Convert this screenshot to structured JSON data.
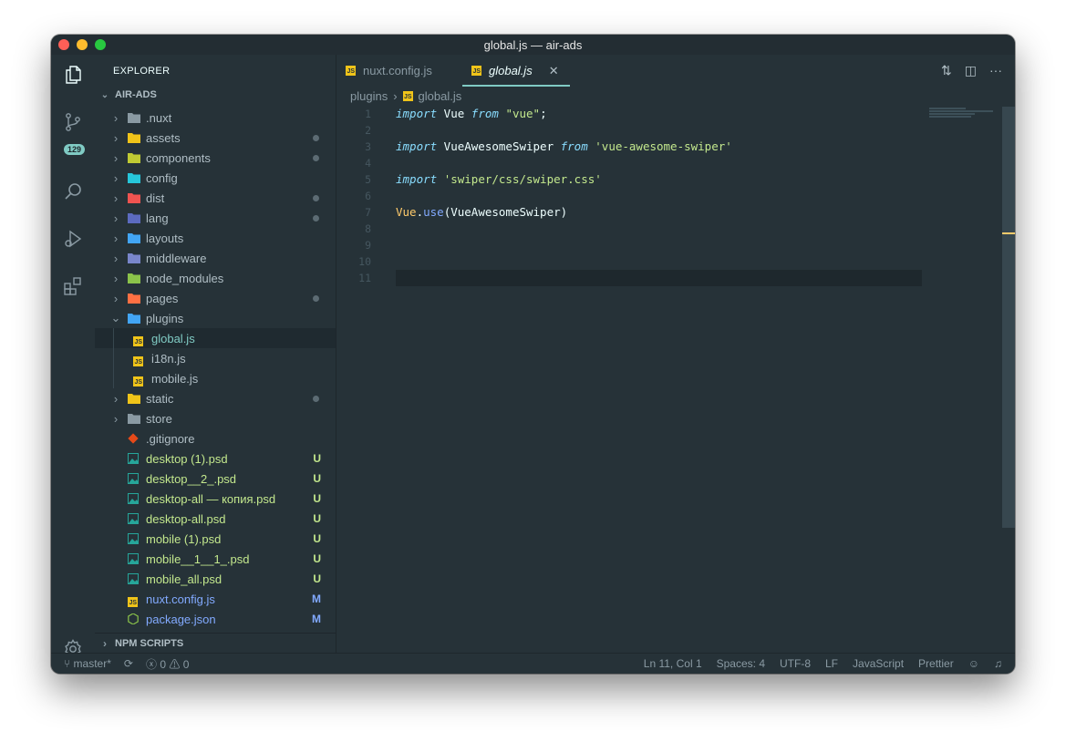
{
  "window": {
    "title": "global.js — air-ads"
  },
  "colors": {
    "accent": "#80cbc4",
    "background": "#263238",
    "untracked": "#c3e88d",
    "modified": "#82aaff"
  },
  "activity": {
    "scm_badge": "129"
  },
  "sidebar": {
    "title": "EXPLORER",
    "project": "AIR-ADS",
    "items": [
      {
        "name": ".nuxt",
        "type": "folder",
        "icon_color": "#8a9aa3",
        "dot": false,
        "status": ""
      },
      {
        "name": "assets",
        "type": "folder",
        "icon_color": "#f0c419",
        "dot": true,
        "status": ""
      },
      {
        "name": "components",
        "type": "folder",
        "icon_color": "#c0ca33",
        "dot": true,
        "status": ""
      },
      {
        "name": "config",
        "type": "folder",
        "icon_color": "#26c6da",
        "dot": false,
        "status": ""
      },
      {
        "name": "dist",
        "type": "folder",
        "icon_color": "#ef5350",
        "dot": true,
        "status": ""
      },
      {
        "name": "lang",
        "type": "folder",
        "icon_color": "#5c6bc0",
        "dot": true,
        "status": ""
      },
      {
        "name": "layouts",
        "type": "folder",
        "icon_color": "#42a5f5",
        "dot": false,
        "status": ""
      },
      {
        "name": "middleware",
        "type": "folder",
        "icon_color": "#7986cb",
        "dot": false,
        "status": ""
      },
      {
        "name": "node_modules",
        "type": "folder",
        "icon_color": "#8bc34a",
        "dot": false,
        "status": ""
      },
      {
        "name": "pages",
        "type": "folder",
        "icon_color": "#ff7043",
        "dot": true,
        "status": ""
      },
      {
        "name": "plugins",
        "type": "folder-open",
        "icon_color": "#42a5f5",
        "dot": false,
        "status": ""
      },
      {
        "name": "global.js",
        "type": "js",
        "dot": false,
        "status": "",
        "nested": true,
        "selected": true
      },
      {
        "name": "i18n.js",
        "type": "js",
        "dot": false,
        "status": "",
        "nested": true
      },
      {
        "name": "mobile.js",
        "type": "js",
        "dot": false,
        "status": "",
        "nested": true
      },
      {
        "name": "static",
        "type": "folder",
        "icon_color": "#f0c419",
        "dot": true,
        "status": ""
      },
      {
        "name": "store",
        "type": "folder",
        "icon_color": "#8a9aa3",
        "dot": false,
        "status": ""
      },
      {
        "name": ".gitignore",
        "type": "git",
        "dot": false,
        "status": ""
      },
      {
        "name": "desktop (1).psd",
        "type": "psd",
        "dot": false,
        "status": "U"
      },
      {
        "name": "desktop__2_.psd",
        "type": "psd",
        "dot": false,
        "status": "U"
      },
      {
        "name": "desktop-all — копия.psd",
        "type": "psd",
        "dot": false,
        "status": "U"
      },
      {
        "name": "desktop-all.psd",
        "type": "psd",
        "dot": false,
        "status": "U"
      },
      {
        "name": "mobile (1).psd",
        "type": "psd",
        "dot": false,
        "status": "U"
      },
      {
        "name": "mobile__1__1_.psd",
        "type": "psd",
        "dot": false,
        "status": "U"
      },
      {
        "name": "mobile_all.psd",
        "type": "psd",
        "dot": false,
        "status": "U"
      },
      {
        "name": "nuxt.config.js",
        "type": "js",
        "dot": false,
        "status": "M"
      },
      {
        "name": "package.json",
        "type": "node",
        "dot": false,
        "status": "M"
      }
    ],
    "npm_scripts": "NPM SCRIPTS"
  },
  "tabs": [
    {
      "label": "nuxt.config.js",
      "active": false
    },
    {
      "label": "global.js",
      "active": true
    }
  ],
  "breadcrumb": {
    "folder": "plugins",
    "file": "global.js"
  },
  "code": {
    "current_line": 11,
    "lines": [
      [
        [
          "kw",
          "import"
        ],
        [
          "t",
          " Vue "
        ],
        [
          "kw",
          "from"
        ],
        [
          "t",
          " "
        ],
        [
          "str",
          "\"vue\""
        ],
        [
          "t",
          ";"
        ]
      ],
      [],
      [
        [
          "kw",
          "import"
        ],
        [
          "t",
          " VueAwesomeSwiper "
        ],
        [
          "kw",
          "from"
        ],
        [
          "t",
          " "
        ],
        [
          "str",
          "'vue-awesome-swiper'"
        ]
      ],
      [],
      [
        [
          "kw",
          "import"
        ],
        [
          "t",
          " "
        ],
        [
          "str",
          "'swiper/css/swiper.css'"
        ]
      ],
      [],
      [
        [
          "obj",
          "Vue"
        ],
        [
          "t",
          "."
        ],
        [
          "fn",
          "use"
        ],
        [
          "t",
          "(VueAwesomeSwiper)"
        ]
      ],
      [],
      [],
      [],
      []
    ]
  },
  "statusbar": {
    "branch": "master*",
    "errors": "0",
    "warnings": "0",
    "position": "Ln 11, Col 1",
    "spaces": "Spaces: 4",
    "encoding": "UTF-8",
    "eol": "LF",
    "language": "JavaScript",
    "formatter": "Prettier"
  }
}
